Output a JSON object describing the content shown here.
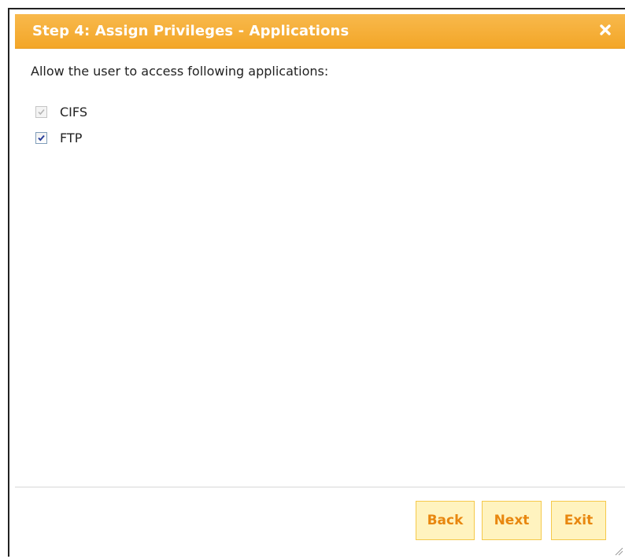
{
  "dialog": {
    "title": "Step 4: Assign Privileges - Applications",
    "close_icon": "close-icon",
    "accent_color": "#f3a628"
  },
  "content": {
    "instruction": "Allow the user to access following applications:",
    "applications": [
      {
        "label": "CIFS",
        "checked": true,
        "disabled": true
      },
      {
        "label": "FTP",
        "checked": true,
        "disabled": false
      }
    ]
  },
  "footer": {
    "back_label": "Back",
    "next_label": "Next",
    "exit_label": "Exit"
  }
}
